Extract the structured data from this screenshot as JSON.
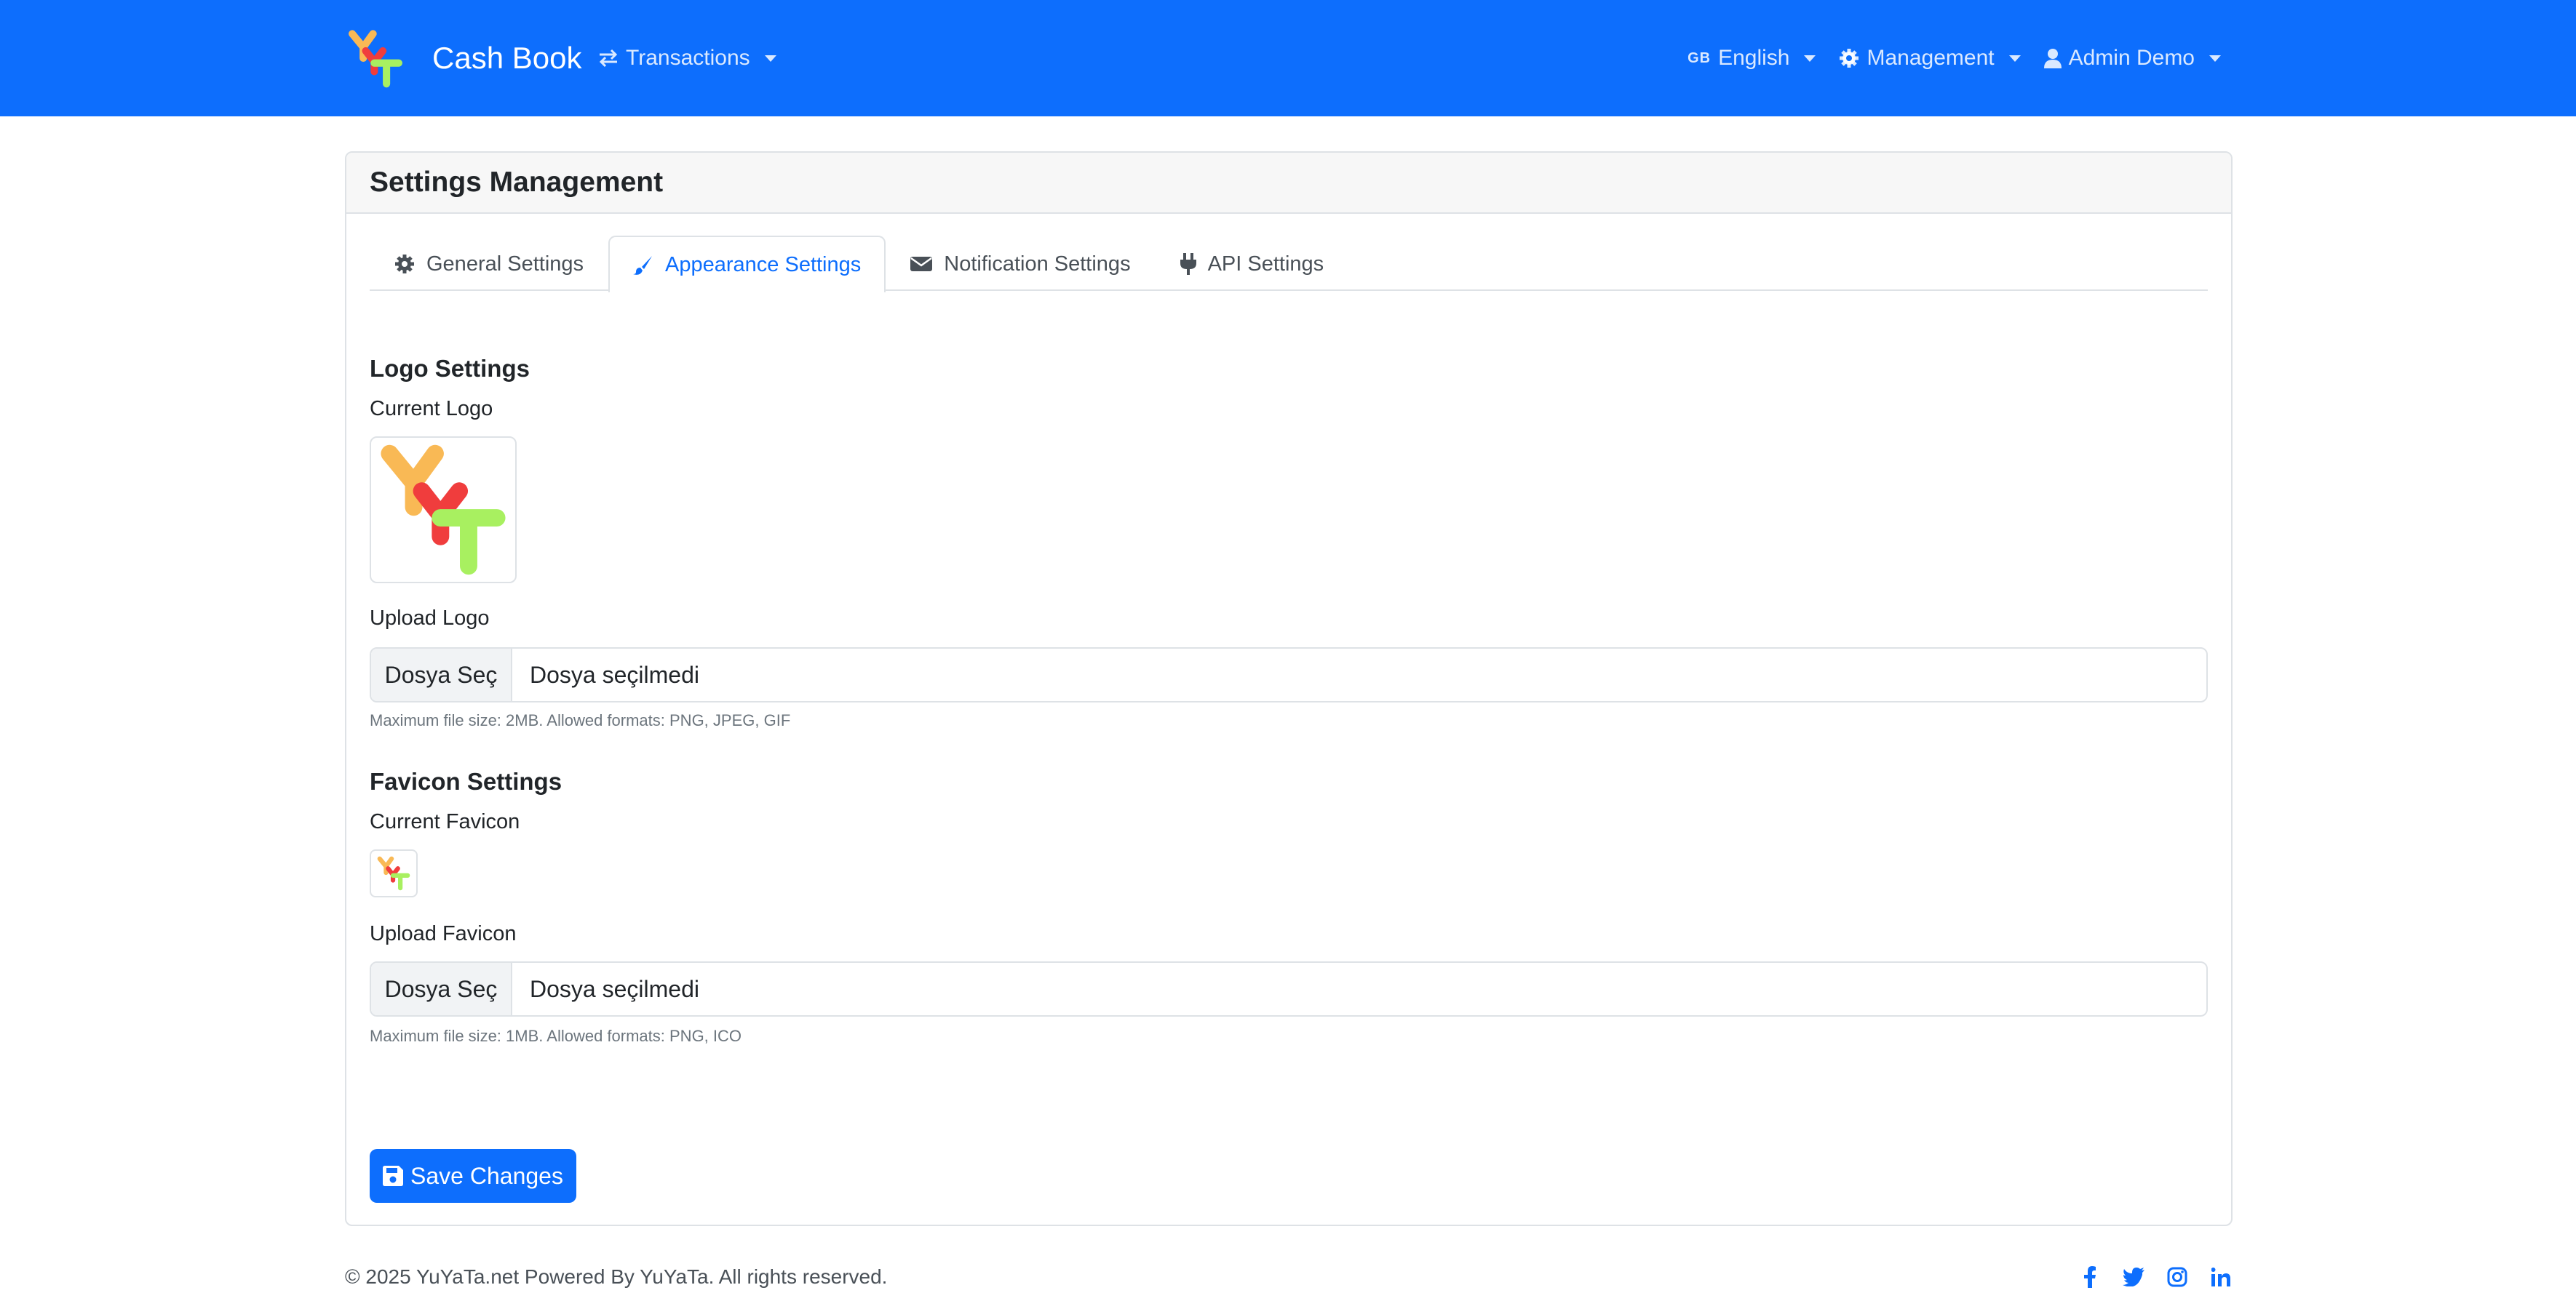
{
  "navbar": {
    "brand": "Cash Book",
    "transactions_label": "Transactions",
    "language_code": "GB",
    "language_label": "English",
    "management_label": "Management",
    "user_label": "Admin Demo"
  },
  "card": {
    "title": "Settings Management",
    "tabs": [
      {
        "label": "General Settings",
        "icon": "gear-icon",
        "active": false
      },
      {
        "label": "Appearance Settings",
        "icon": "brush-icon",
        "active": true
      },
      {
        "label": "Notification Settings",
        "icon": "envelope-icon",
        "active": false
      },
      {
        "label": "API Settings",
        "icon": "plug-icon",
        "active": false
      }
    ]
  },
  "logo": {
    "section_title": "Logo Settings",
    "current_label": "Current Logo",
    "upload_label": "Upload Logo",
    "choose_button": "Dosya Seç",
    "file_status": "Dosya seçilmedi",
    "help": "Maximum file size: 2MB. Allowed formats: PNG, JPEG, GIF"
  },
  "favicon": {
    "section_title": "Favicon Settings",
    "current_label": "Current Favicon",
    "upload_label": "Upload Favicon",
    "choose_button": "Dosya Seç",
    "file_status": "Dosya seçilmedi",
    "help": "Maximum file size: 1MB. Allowed formats: PNG, ICO"
  },
  "save_button": "Save Changes",
  "footer": {
    "copyright": "© 2025 YuYaTa.net Powered By YuYaTa. All rights reserved.",
    "social": [
      "facebook-icon",
      "twitter-icon",
      "instagram-icon",
      "linkedin-icon"
    ]
  },
  "colors": {
    "primary": "#0d6efd",
    "logo_orange": "#f9b955",
    "logo_red": "#f03d3d",
    "logo_green": "#a8f060"
  }
}
